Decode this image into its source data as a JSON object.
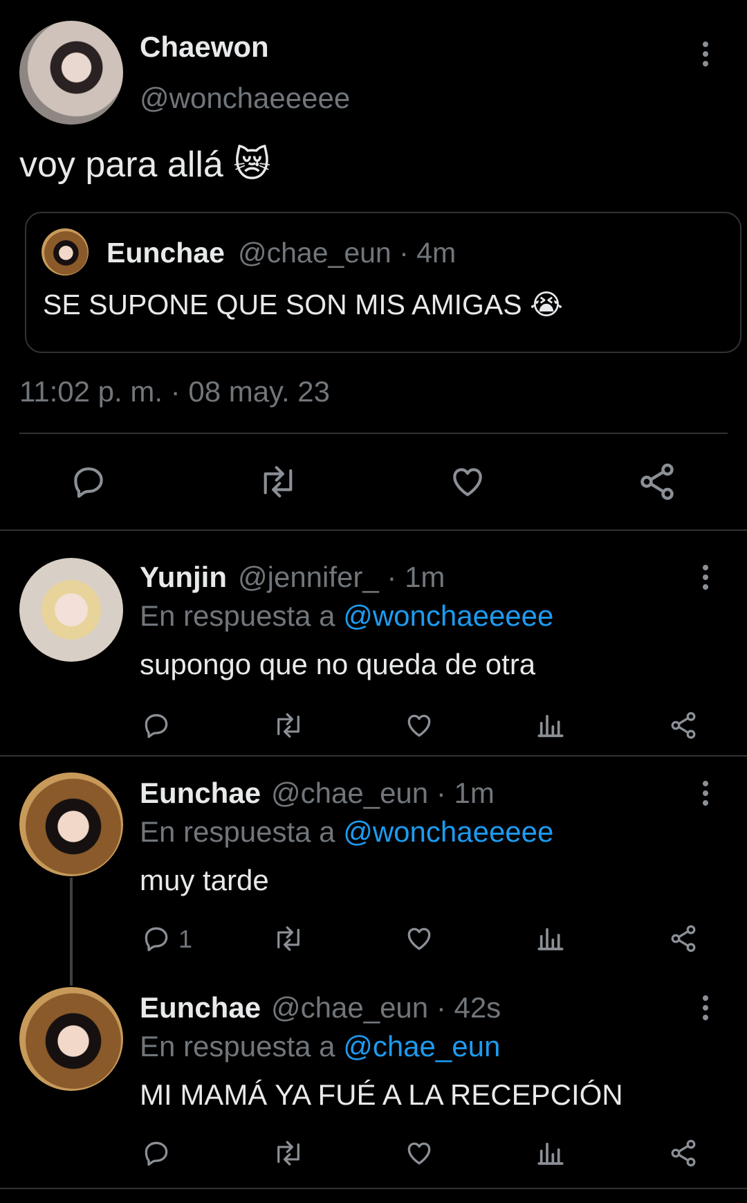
{
  "main_tweet": {
    "author": {
      "name": "Chaewon",
      "handle": "@wonchaeeeee"
    },
    "text": "voy para allá 😿",
    "quoted": {
      "author_name": "Eunchae",
      "meta": "@chae_eun · 4m",
      "text": "SE SUPONE QUE SON MIS AMIGAS 😭"
    },
    "timestamp": "11:02 p. m. · 08 may. 23",
    "actions": [
      "reply-icon",
      "retweet-icon",
      "like-icon",
      "share-icon"
    ]
  },
  "replies": [
    {
      "name": "Yunjin",
      "meta": "@jennifer_ · 1m",
      "reply_prefix": "En respuesta a",
      "reply_to": "@wonchaeeeee",
      "text": "supongo que no queda de otra",
      "reply_count": ""
    },
    {
      "name": "Eunchae",
      "meta": "@chae_eun · 1m",
      "reply_prefix": "En respuesta a",
      "reply_to": "@wonchaeeeee",
      "text": "muy tarde",
      "reply_count": "1"
    },
    {
      "name": "Eunchae",
      "meta": "@chae_eun · 42s",
      "reply_prefix": "En respuesta a",
      "reply_to": "@chae_eun",
      "text": "MI MAMÁ YA FUÉ A LA RECEPCIÓN",
      "reply_count": ""
    }
  ],
  "colors": {
    "background": "#000000",
    "text": "#e7e9ea",
    "muted": "#71767b",
    "link": "#1d9bf0",
    "border": "#2f3336"
  }
}
